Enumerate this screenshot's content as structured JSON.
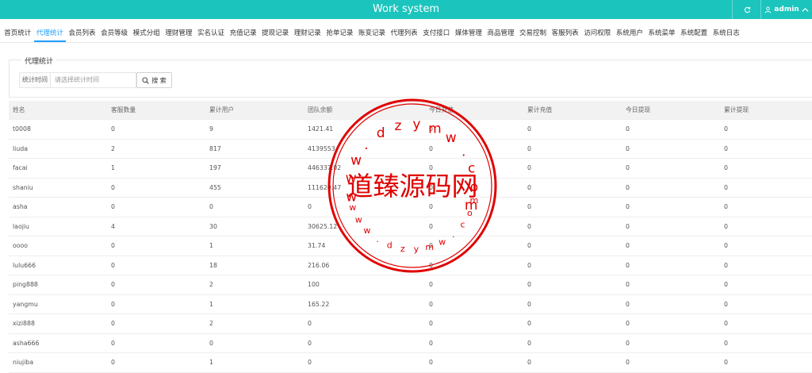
{
  "header": {
    "title": "Work system",
    "user": "admin",
    "refresh_icon": "refresh-icon",
    "user_icon": "user-icon",
    "accent": "#1bc5bd"
  },
  "nav": {
    "active_color": "#1e9fff",
    "items": [
      {
        "label": "首页统计"
      },
      {
        "label": "代理统计",
        "active": true
      },
      {
        "label": "会员列表"
      },
      {
        "label": "会员等级"
      },
      {
        "label": "模式分组"
      },
      {
        "label": "理财管理"
      },
      {
        "label": "实名认证"
      },
      {
        "label": "充值记录"
      },
      {
        "label": "提现记录"
      },
      {
        "label": "理财记录"
      },
      {
        "label": "抢单记录"
      },
      {
        "label": "账变记录"
      },
      {
        "label": "代理列表"
      },
      {
        "label": "支付接口"
      },
      {
        "label": "媒体管理"
      },
      {
        "label": "商品管理"
      },
      {
        "label": "交易控制"
      },
      {
        "label": "客服列表"
      },
      {
        "label": "访问权限"
      },
      {
        "label": "系统用户"
      },
      {
        "label": "系统菜单"
      },
      {
        "label": "系统配置"
      },
      {
        "label": "系统日志"
      }
    ]
  },
  "filter": {
    "legend": "代理统计",
    "time_label": "统计时间",
    "time_placeholder": "请选择统计时间",
    "search_label": "搜 索"
  },
  "table": {
    "columns": [
      "姓名",
      "客服数量",
      "累计用户",
      "团队余额",
      "今日充值",
      "累计充值",
      "今日提现",
      "累计提现"
    ],
    "rows": [
      [
        "t0008",
        "0",
        "9",
        "1421.41",
        "0",
        "0",
        "0",
        "0"
      ],
      [
        "liuda",
        "2",
        "817",
        "4139553",
        "0",
        "0",
        "0",
        "0"
      ],
      [
        "facai",
        "1",
        "197",
        "446337.02",
        "0",
        "0",
        "0",
        "0"
      ],
      [
        "shaniu",
        "0",
        "455",
        "111620.47",
        "0",
        "0",
        "0",
        "0"
      ],
      [
        "asha",
        "0",
        "0",
        "0",
        "0",
        "0",
        "0",
        "0"
      ],
      [
        "laojiu",
        "4",
        "30",
        "30625.12",
        "0",
        "0",
        "0",
        "0"
      ],
      [
        "oooo",
        "0",
        "1",
        "31.74",
        "0",
        "0",
        "0",
        "0"
      ],
      [
        "lulu666",
        "0",
        "18",
        "216.06",
        "0",
        "0",
        "0",
        "0"
      ],
      [
        "ping888",
        "0",
        "2",
        "100",
        "0",
        "0",
        "0",
        "0"
      ],
      [
        "yangmu",
        "0",
        "1",
        "165.22",
        "0",
        "0",
        "0",
        "0"
      ],
      [
        "xizi888",
        "0",
        "2",
        "0",
        "0",
        "0",
        "0",
        "0"
      ],
      [
        "asha666",
        "0",
        "0",
        "0",
        "0",
        "0",
        "0",
        "0"
      ],
      [
        "niujiba",
        "0",
        "1",
        "0",
        "0",
        "0",
        "0",
        "0"
      ]
    ]
  },
  "watermark": {
    "text": "道臻源码网",
    "top_chars": [
      "w",
      "w",
      "w",
      ".",
      "d",
      "z",
      "y",
      "m",
      "w",
      ".",
      "c",
      "o",
      "m"
    ],
    "bottom_chars": [
      "w",
      "w",
      "w",
      ".",
      "d",
      "z",
      "y",
      "m",
      "w",
      ".",
      "c",
      "o",
      "m"
    ],
    "color": "#e00000"
  }
}
